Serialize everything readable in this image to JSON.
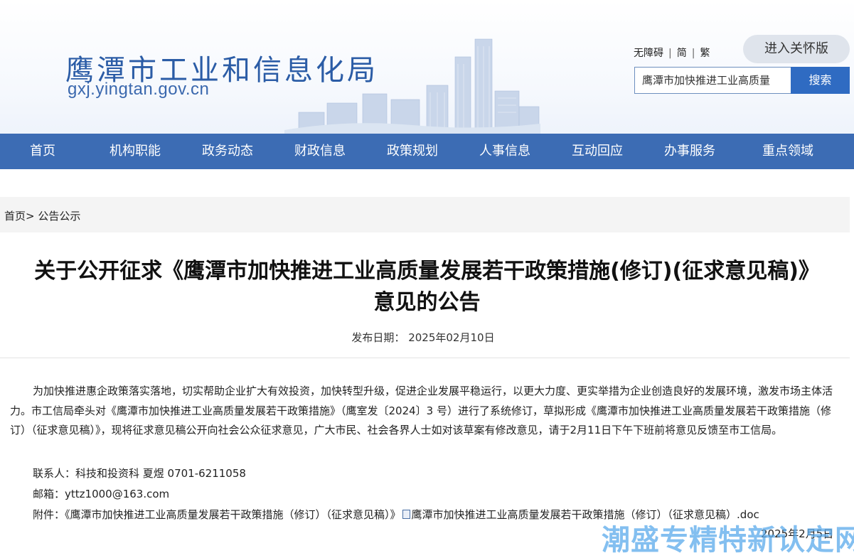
{
  "header": {
    "site_title": "鹰潭市工业和信息化局",
    "site_domain": "gxj.yingtan.gov.cn",
    "accessibility_link": "无障碍",
    "simplified_link": "简",
    "traditional_link": "繁",
    "care_mode_button": "进入关怀版",
    "search_value": "鹰潭市加快推进工业高质量",
    "search_button": "搜索"
  },
  "nav": {
    "items": [
      "首页",
      "机构职能",
      "政务动态",
      "财政信息",
      "政策规划",
      "人事信息",
      "互动回应",
      "办事服务",
      "重点领域"
    ]
  },
  "breadcrumb": {
    "home": "首页",
    "separator": ">",
    "current": "公告公示"
  },
  "article": {
    "title_line1": "关于公开征求《鹰潭市加快推进工业高质量发展若干政策措施(修订)(征求意见稿)》",
    "title_line2": "意见的公告",
    "date_label": "发布日期：",
    "date_value": "2025年02月10日",
    "paragraph": "为加快推进惠企政策落实落地，切实帮助企业扩大有效投资，加快转型升级，促进企业发展平稳运行，以更大力度、更实举措为企业创造良好的发展环境，激发市场主体活力。市工信局牵头对《鹰潭市加快推进工业高质量发展若干政策措施》（鹰室发〔2024〕3 号）进行了系统修订，草拟形成《鹰潭市加快推进工业高质量发展若干政策措施（修订）（征求意见稿）》，现将征求意见稿公开向社会公众征求意见，广大市民、社会各界人士如对该草案有修改意见，请于2月11日下午下班前将意见反馈至市工信局。",
    "contact": "联系人：科技和投资科 夏煜 0701-6211058",
    "email_label": "邮箱：",
    "email_value": "yttz1000@163.com",
    "attachment_label": "附件：",
    "attachment_title": "《鹰潭市加快推进工业高质量发展若干政策措施（修订）（征求意见稿）》",
    "attachment_file": "鹰潭市加快推进工业高质量发展若干政策措施（修订）（征求意见稿）.doc",
    "sign_date": "2025年2月5日"
  },
  "watermark": "潮盛专精特新认定网",
  "colors": {
    "brand_blue": "#3c6cb4",
    "search_blue": "#2f6bc2",
    "title_blue": "#2b5ca6"
  }
}
